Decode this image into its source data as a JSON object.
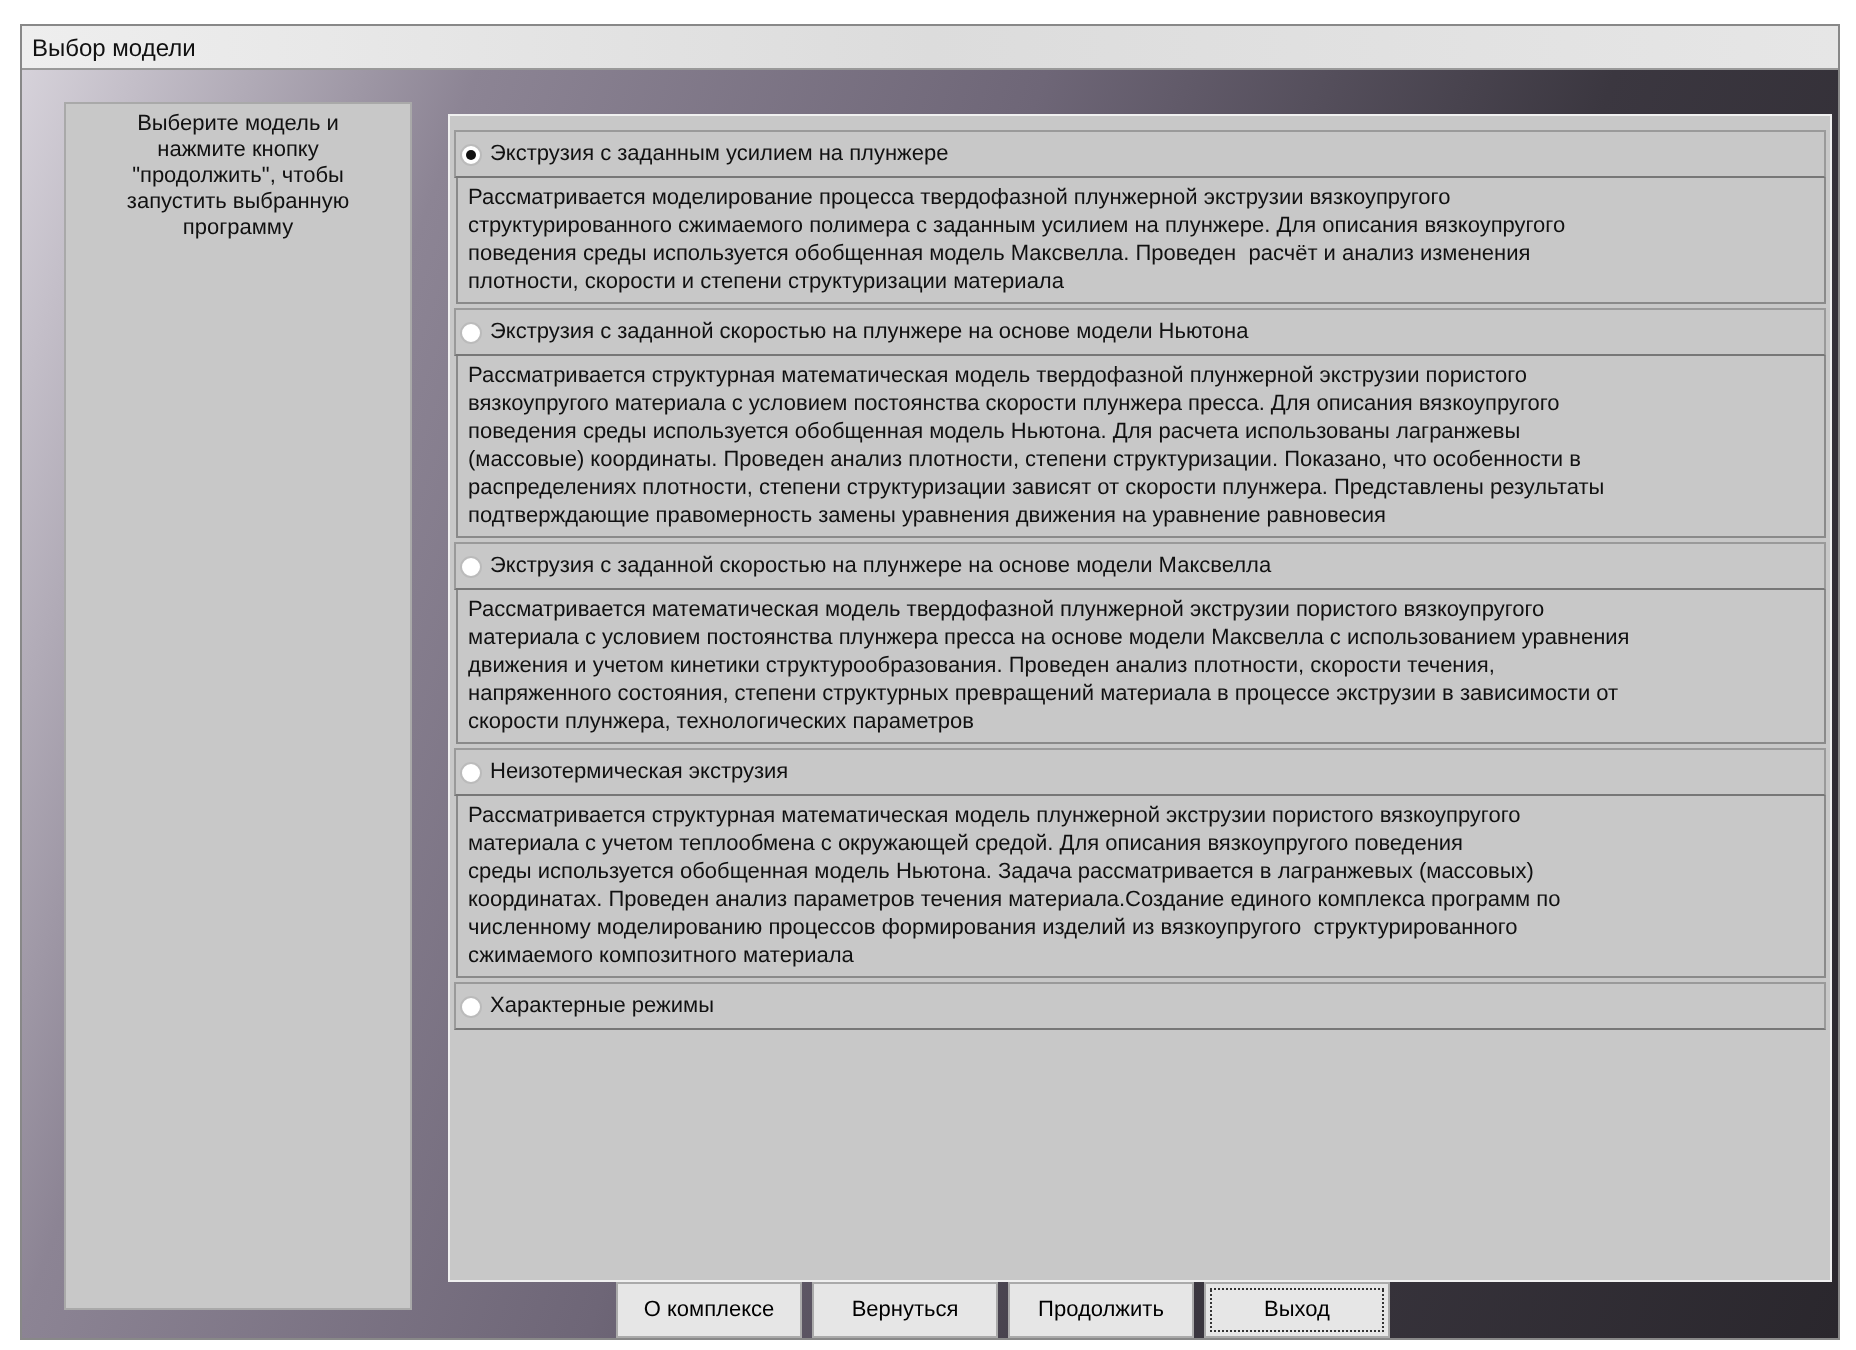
{
  "window": {
    "title": "Выбор модели"
  },
  "hint": "Выберите модель и нажмите кнопку \"продолжить\", чтобы запустить выбранную программу",
  "models": [
    {
      "label": "Экструзия с заданным усилием на плунжере",
      "selected": true,
      "description": "Рассматривается моделирование процесса твердофазной плунжерной экструзии вязкоупругого\nструктурированного сжимаемого полимера с заданным усилием на плунжере. Для описания вязкоупругого\nповедения среды используется обобщенная модель Максвелла. Проведен  расчёт и анализ изменения\nплотности, скорости и степени структуризации материала"
    },
    {
      "label": "Экструзия с заданной скоростью на плунжере на основе модели Ньютона",
      "selected": false,
      "description": "Рассматривается структурная математическая модель твердофазной плунжерной экструзии пористого\nвязкоупругого материала с условием постоянства скорости плунжера пресса. Для описания вязкоупругого\nповедения среды используется обобщенная модель Ньютона. Для расчета использованы лагранжевы\n(массовые) координаты. Проведен анализ плотности, степени структуризации. Показано, что особенности в\nраспределениях плотности, степени структуризации зависят от скорости плунжера. Представлены результаты\nподтверждающие правомерность замены уравнения движения на уравнение равновесия"
    },
    {
      "label": "Экструзия с заданной скоростью на плунжере на основе модели Максвелла",
      "selected": false,
      "description": "Рассматривается математическая модель твердофазной плунжерной экструзии пористого вязкоупругого\nматериала с условием постоянства плунжера пресса на основе модели Максвелла с использованием уравнения\nдвижения и учетом кинетики структурообразования. Проведен анализ плотности, скорости течения,\nнапряженного состояния, степени структурных превращений материала в процессе экструзии в зависимости от\nскорости плунжера, технологических параметров"
    },
    {
      "label": "Неизотермическая экструзия",
      "selected": false,
      "description": "Рассматривается структурная математическая модель плунжерной экструзии пористого вязкоупругого\nматериала с учетом теплообмена с окружающей средой. Для описания вязкоупругого поведения\nсреды используется обобщенная модель Ньютона. Задача рассматривается в лагранжевых (массовых)\nкоординатах. Проведен анализ параметров течения материала.Создание единого комплекса программ по\nчисленному моделированию процессов формирования изделий из вязкоупругого  структурированного\nсжимаемого композитного материала"
    },
    {
      "label": "Характерные режимы",
      "selected": false
    }
  ],
  "buttons": [
    {
      "label": "О комплексе",
      "focused": false
    },
    {
      "label": "Вернуться",
      "focused": false
    },
    {
      "label": "Продолжить",
      "focused": false
    },
    {
      "label": "Выход",
      "focused": true
    }
  ]
}
